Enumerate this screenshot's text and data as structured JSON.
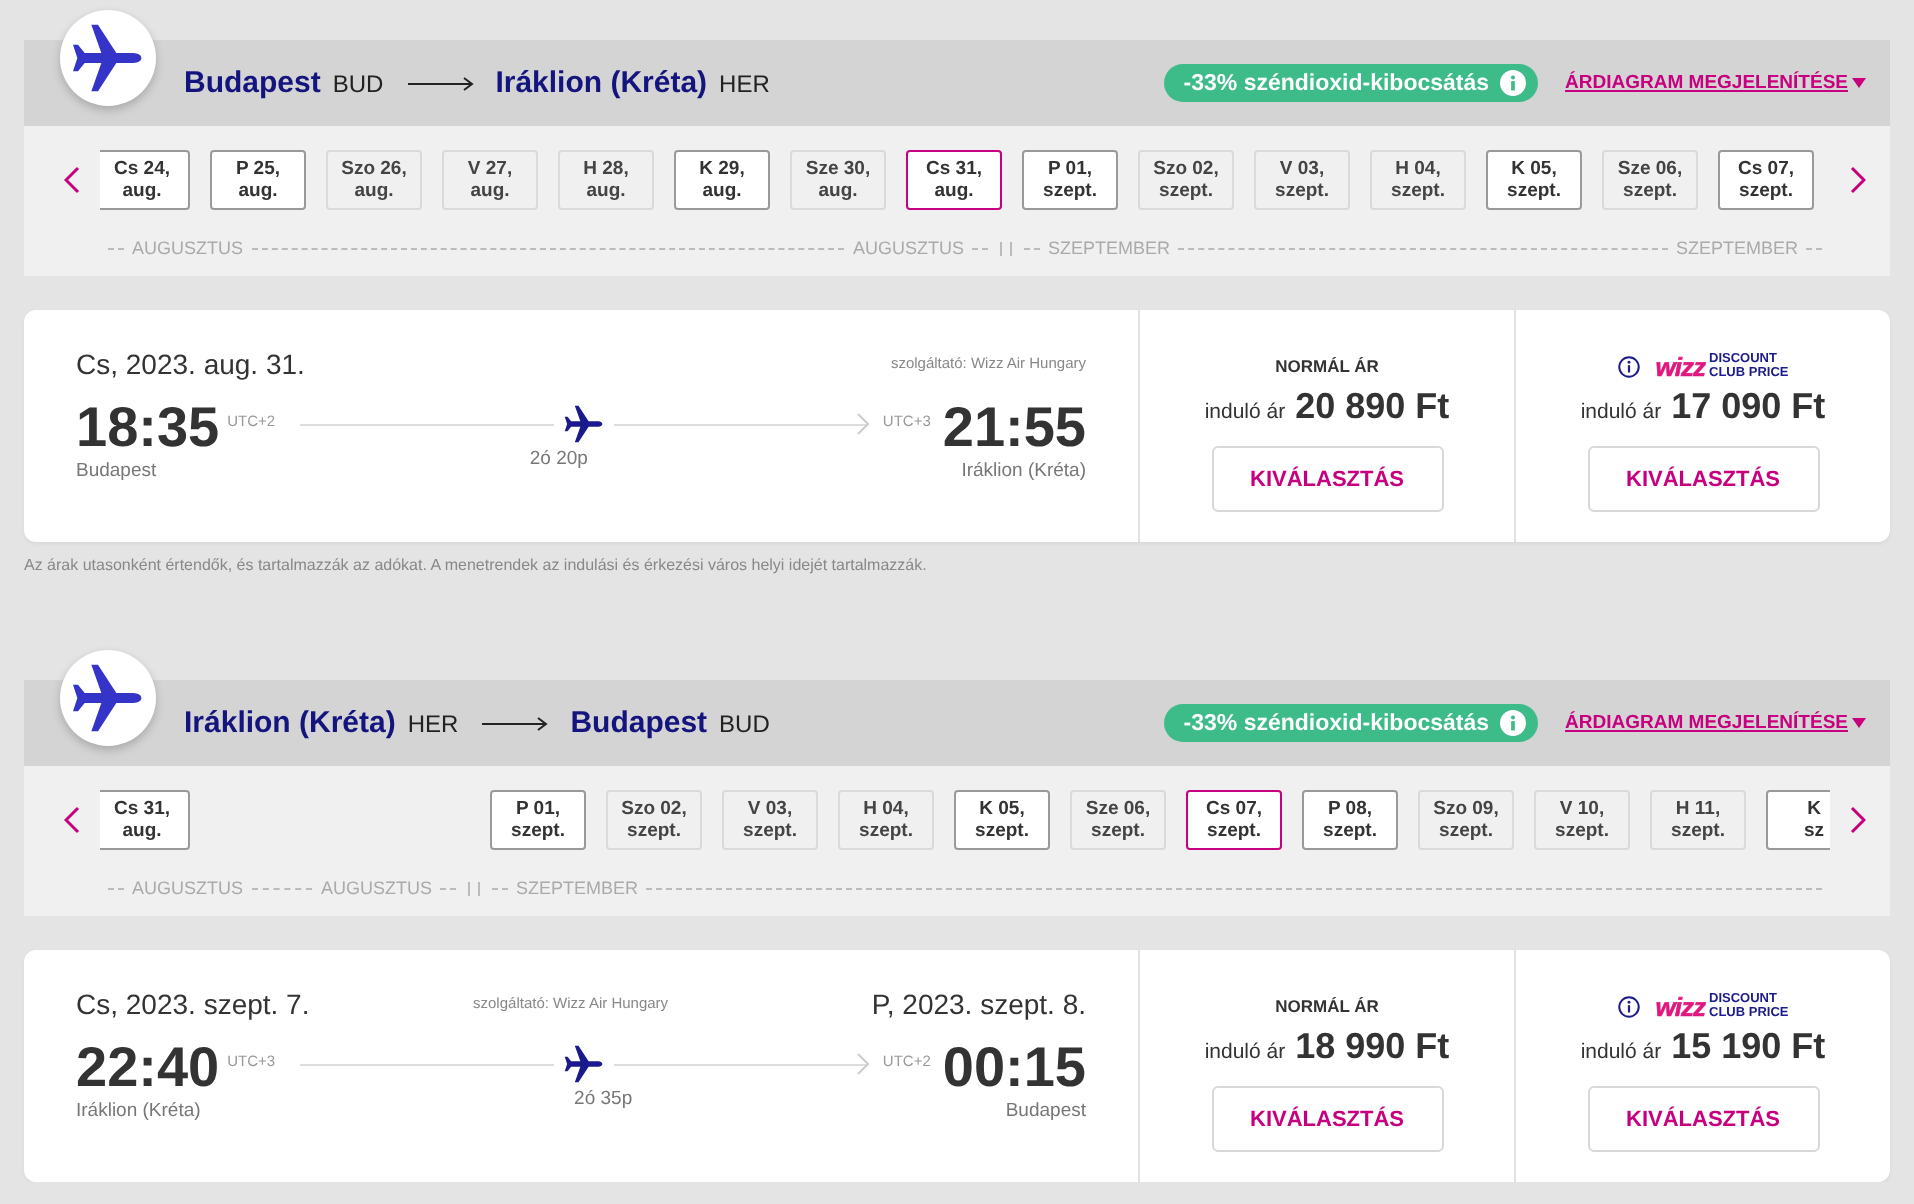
{
  "legs": [
    {
      "route": {
        "from_city": "Budapest",
        "from_code": "BUD",
        "to_city": "Iráklion (Kréta)",
        "to_code": "HER"
      },
      "emission_badge": "-33% széndioxid-kibocsátás",
      "chart_link": "ÁRDIAGRAM MEGJELENÍTÉSE",
      "dates": [
        {
          "day": "Cs 24,",
          "month": "aug.",
          "available": true,
          "selected": false
        },
        {
          "day": "P 25,",
          "month": "aug.",
          "available": true,
          "selected": false
        },
        {
          "day": "Szo 26,",
          "month": "aug.",
          "available": false,
          "selected": false
        },
        {
          "day": "V 27,",
          "month": "aug.",
          "available": false,
          "selected": false
        },
        {
          "day": "H 28,",
          "month": "aug.",
          "available": false,
          "selected": false
        },
        {
          "day": "K 29,",
          "month": "aug.",
          "available": true,
          "selected": false
        },
        {
          "day": "Sze 30,",
          "month": "aug.",
          "available": false,
          "selected": false
        },
        {
          "day": "Cs 31,",
          "month": "aug.",
          "available": true,
          "selected": true
        },
        {
          "day": "P 01,",
          "month": "szept.",
          "available": true,
          "selected": false
        },
        {
          "day": "Szo 02,",
          "month": "szept.",
          "available": false,
          "selected": false
        },
        {
          "day": "V 03,",
          "month": "szept.",
          "available": false,
          "selected": false
        },
        {
          "day": "H 04,",
          "month": "szept.",
          "available": false,
          "selected": false
        },
        {
          "day": "K 05,",
          "month": "szept.",
          "available": true,
          "selected": false
        },
        {
          "day": "Sze 06,",
          "month": "szept.",
          "available": false,
          "selected": false
        },
        {
          "day": "Cs 07,",
          "month": "szept.",
          "available": true,
          "selected": false
        }
      ],
      "months": [
        {
          "start": "AUGUSZTUS",
          "end": "AUGUSZTUS"
        },
        {
          "start": "SZEPTEMBER",
          "end": "SZEPTEMBER"
        }
      ],
      "flight": {
        "departure_date": "Cs, 2023. aug. 31.",
        "operator": "szolgáltató: Wizz Air Hungary",
        "departure_time": "18:35",
        "departure_utc": "UTC+2",
        "departure_city": "Budapest",
        "duration": "2ó 20p",
        "arrival_utc": "UTC+3",
        "arrival_time": "21:55",
        "arrival_city": "Iráklion (Kréta)"
      },
      "fares": [
        {
          "kind": "normal",
          "label": "NORMÁL ÁR",
          "prefix": "induló ár",
          "price": "20 890 Ft",
          "button": "KIVÁLASZTÁS"
        },
        {
          "kind": "club",
          "brand": "wizz",
          "brand_lines": [
            "DISCOUNT",
            "CLUB PRICE"
          ],
          "prefix": "induló ár",
          "price": "17 090 Ft",
          "button": "KIVÁLASZTÁS"
        }
      ],
      "disclaimer": "Az árak utasonként értendők, és tartalmazzák az adókat. A menetrendek az indulási és érkezési város helyi idejét tartalmazzák."
    },
    {
      "route": {
        "from_city": "Iráklion (Kréta)",
        "from_code": "HER",
        "to_city": "Budapest",
        "to_code": "BUD"
      },
      "emission_badge": "-33% széndioxid-kibocsátás",
      "chart_link": "ÁRDIAGRAM MEGJELENÍTÉSE",
      "dates": [
        {
          "day": "Cs 31,",
          "month": "aug.",
          "available": true,
          "selected": false
        },
        {
          "day": "P 01,",
          "month": "szept.",
          "available": true,
          "selected": false,
          "gap_before": true
        },
        {
          "day": "Szo 02,",
          "month": "szept.",
          "available": false,
          "selected": false
        },
        {
          "day": "V 03,",
          "month": "szept.",
          "available": false,
          "selected": false
        },
        {
          "day": "H 04,",
          "month": "szept.",
          "available": false,
          "selected": false
        },
        {
          "day": "K 05,",
          "month": "szept.",
          "available": true,
          "selected": false
        },
        {
          "day": "Sze 06,",
          "month": "szept.",
          "available": false,
          "selected": false
        },
        {
          "day": "Cs 07,",
          "month": "szept.",
          "available": true,
          "selected": true
        },
        {
          "day": "P 08,",
          "month": "szept.",
          "available": true,
          "selected": false
        },
        {
          "day": "Szo 09,",
          "month": "szept.",
          "available": false,
          "selected": false
        },
        {
          "day": "V 10,",
          "month": "szept.",
          "available": false,
          "selected": false
        },
        {
          "day": "H 11,",
          "month": "szept.",
          "available": false,
          "selected": false
        },
        {
          "day": "K",
          "month": "sz",
          "available": true,
          "selected": false
        }
      ],
      "months": [
        {
          "start": "AUGUSZTUS",
          "end": "AUGUSZTUS"
        },
        {
          "start": "SZEPTEMBER"
        }
      ],
      "flight": {
        "departure_date": "Cs, 2023. szept. 7.",
        "operator": "szolgáltató: Wizz Air Hungary",
        "arrival_date": "P, 2023. szept. 8.",
        "departure_time": "22:40",
        "departure_utc": "UTC+3",
        "departure_city": "Iráklion (Kréta)",
        "duration": "2ó 35p",
        "arrival_utc": "UTC+2",
        "arrival_time": "00:15",
        "arrival_city": "Budapest"
      },
      "fares": [
        {
          "kind": "normal",
          "label": "NORMÁL ÁR",
          "prefix": "induló ár",
          "price": "18 990 Ft",
          "button": "KIVÁLASZTÁS"
        },
        {
          "kind": "club",
          "brand": "wizz",
          "brand_lines": [
            "DISCOUNT",
            "CLUB PRICE"
          ],
          "prefix": "induló ár",
          "price": "15 190 Ft",
          "button": "KIVÁLASZTÁS"
        }
      ]
    }
  ]
}
